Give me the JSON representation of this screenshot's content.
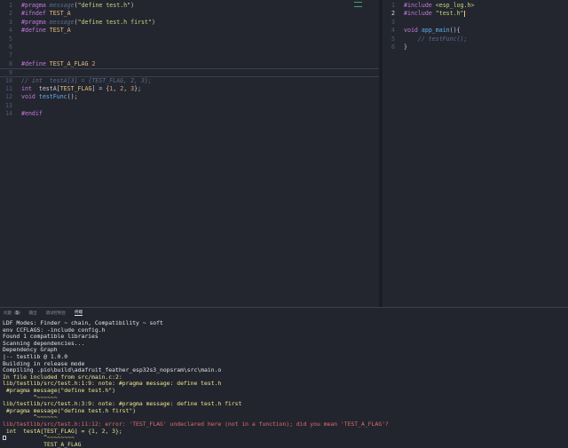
{
  "left_editor": {
    "lines": [
      {
        "n": "1",
        "tokens": [
          [
            "kw",
            "#pragma"
          ],
          [
            "pl",
            " "
          ],
          [
            "cm",
            "message"
          ],
          [
            "pl",
            "("
          ],
          [
            "str",
            "\"define test.h\""
          ],
          [
            "pl",
            ")"
          ]
        ]
      },
      {
        "n": "2",
        "tokens": [
          [
            "kw",
            "#ifndef"
          ],
          [
            "pl",
            " "
          ],
          [
            "mac",
            "TEST_A"
          ]
        ]
      },
      {
        "n": "3",
        "tokens": [
          [
            "kw",
            "#pragma"
          ],
          [
            "pl",
            " "
          ],
          [
            "cm",
            "message"
          ],
          [
            "pl",
            "("
          ],
          [
            "str",
            "\"define test.h first\""
          ],
          [
            "pl",
            ")"
          ]
        ]
      },
      {
        "n": "4",
        "tokens": [
          [
            "kw",
            "#define"
          ],
          [
            "pl",
            " "
          ],
          [
            "mac",
            "TEST_A"
          ]
        ]
      },
      {
        "n": "5",
        "tokens": []
      },
      {
        "n": "6",
        "tokens": []
      },
      {
        "n": "7",
        "tokens": []
      },
      {
        "n": "8",
        "tokens": [
          [
            "kw",
            "#define"
          ],
          [
            "pl",
            " "
          ],
          [
            "mac",
            "TEST_A_FLAG"
          ],
          [
            "pl",
            " "
          ],
          [
            "num",
            "2"
          ]
        ]
      },
      {
        "n": "9",
        "tokens": [],
        "current": true
      },
      {
        "n": "10",
        "tokens": [
          [
            "cm",
            "// int  testA[3] = {TEST_FLAG, 2, 3};"
          ]
        ]
      },
      {
        "n": "11",
        "tokens": [
          [
            "kw",
            "int"
          ],
          [
            "pl",
            "  testA["
          ],
          [
            "mac",
            "TEST_FLAG"
          ],
          [
            "pl",
            "] = {"
          ],
          [
            "num",
            "1"
          ],
          [
            "pl",
            ", "
          ],
          [
            "num",
            "2"
          ],
          [
            "pl",
            ", "
          ],
          [
            "num",
            "3"
          ],
          [
            "pl",
            "};"
          ]
        ]
      },
      {
        "n": "12",
        "tokens": [
          [
            "kw",
            "void"
          ],
          [
            "pl",
            " "
          ],
          [
            "fn",
            "testFunc"
          ],
          [
            "pl",
            "();"
          ]
        ]
      },
      {
        "n": "13",
        "tokens": []
      },
      {
        "n": "14",
        "tokens": [
          [
            "kw",
            "#endif"
          ]
        ]
      }
    ]
  },
  "right_editor": {
    "lines": [
      {
        "n": "1",
        "tokens": [
          [
            "kw",
            "#include"
          ],
          [
            "pl",
            " "
          ],
          [
            "str",
            "<esp_log.h>"
          ]
        ]
      },
      {
        "n": "2",
        "tokens": [
          [
            "kw",
            "#include"
          ],
          [
            "pl",
            " "
          ],
          [
            "str",
            "\"test.h\""
          ]
        ],
        "active": true
      },
      {
        "n": "3",
        "tokens": []
      },
      {
        "n": "4",
        "tokens": [
          [
            "kw",
            "void"
          ],
          [
            "pl",
            " "
          ],
          [
            "fn",
            "app_main"
          ],
          [
            "pl",
            "(){"
          ]
        ]
      },
      {
        "n": "5",
        "tokens": [
          [
            "pl",
            "    "
          ],
          [
            "cm",
            "// testFunc();"
          ]
        ]
      },
      {
        "n": "6",
        "tokens": [
          [
            "pl",
            "}"
          ]
        ]
      }
    ]
  },
  "panel_tabs": [
    {
      "label": "问题",
      "badge": "5"
    },
    {
      "label": "输出",
      "badge": ""
    },
    {
      "label": "调试控制台",
      "badge": ""
    },
    {
      "label": "终端",
      "badge": "",
      "active": true
    }
  ],
  "terminal": [
    {
      "c": "t-white",
      "t": "LDF Modes: Finder ~ chain, Compatibility ~ soft"
    },
    {
      "c": "t-white",
      "t": "env CCFLAGS: -include config.h"
    },
    {
      "c": "t-white",
      "t": "Found 1 compatible libraries"
    },
    {
      "c": "t-white",
      "t": "Scanning dependencies..."
    },
    {
      "c": "t-white",
      "t": "Dependency Graph"
    },
    {
      "c": "t-white",
      "t": "|-- testlib @ 1.0.0"
    },
    {
      "c": "t-white",
      "t": "Building in release mode"
    },
    {
      "c": "t-white",
      "t": "Compiling .pio\\build\\adafruit_feather_esp32s3_nopsram\\src\\main.o"
    },
    {
      "c": "t-yellow",
      "t": "In file included from src/main.c:2:"
    },
    {
      "c": "t-yellow",
      "t": "lib/testlib/src/test.h:1:9: note: #pragma message: define test.h"
    },
    {
      "c": "t-yellow",
      "t": " #pragma message(\"define test.h\")"
    },
    {
      "c": "t-yellow",
      "t": "         ^~~~~~~"
    },
    {
      "c": "t-yellow",
      "t": "lib/testlib/src/test.h:3:9: note: #pragma message: define test.h first"
    },
    {
      "c": "t-yellow",
      "t": " #pragma message(\"define test.h first\")"
    },
    {
      "c": "t-yellow",
      "t": "         ^~~~~~~"
    },
    {
      "c": "t-red",
      "t": "lib/testlib/src/test.h:11:12: error: 'TEST_FLAG' undeclared here (not in a function); did you mean 'TEST_A_FLAG'?"
    },
    {
      "c": "t-yellow",
      "t": " int  testA[TEST_FLAG] = {1, 2, 3};"
    },
    {
      "c": "t-yellow",
      "t": "            ^~~~~~~~~"
    },
    {
      "c": "t-yellow",
      "t": "            TEST_A_FLAG"
    }
  ],
  "colors": {
    "editor_bg": "#23262f",
    "keyword": "#c678dd",
    "macro": "#e5c07b",
    "string": "#c8d57a",
    "error": "#e06c6c",
    "warning": "#f0e68c"
  }
}
